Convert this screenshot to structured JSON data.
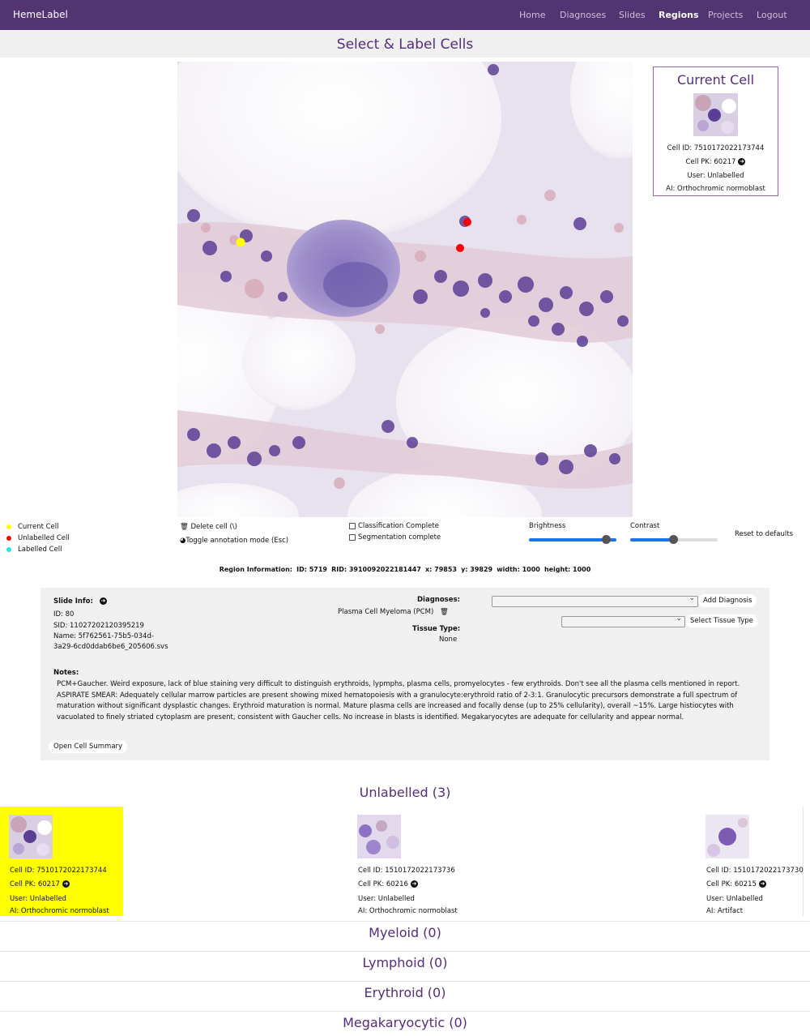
{
  "app": {
    "brand": "HemeLabel",
    "nav": [
      {
        "label": "Home",
        "active": false
      },
      {
        "label": "Diagnoses",
        "active": false
      },
      {
        "label": "Slides",
        "active": false
      },
      {
        "label": "Regions",
        "active": true
      },
      {
        "label": "Projects",
        "active": false
      },
      {
        "label": "Logout",
        "active": false
      }
    ]
  },
  "page_title": "Select & Label Cells",
  "current_cell": {
    "title": "Current Cell",
    "cell_id": "Cell ID: 7510172022173744",
    "cell_pk": "Cell PK: 60217",
    "user": "User: Unlabelled",
    "ai": "AI: Orthochromic normoblast"
  },
  "legend": {
    "current": "Current Cell",
    "unlabelled": "Unlabelled Cell",
    "labelled": "Labelled Cell"
  },
  "controls": {
    "delete": "Delete cell (\\)",
    "toggle": "Toggle annotation mode (Esc)",
    "classification": "Classification Complete",
    "segmentation": "Segmentation complete",
    "brightness": "Brightness",
    "contrast": "Contrast",
    "reset": "Reset to defaults",
    "brightness_value": 0.93,
    "contrast_value": 0.49
  },
  "region_info": {
    "label": "Region Information:",
    "id": "ID: 5719",
    "rid": "RID: 3910092022181447",
    "x": "x: 79853",
    "y": "y: 39829",
    "width": "width: 1000",
    "height": "height: 1000"
  },
  "slide": {
    "label": "Slide Info:",
    "id": "ID: 80",
    "sid": "SID: 11027202120395219",
    "name_line1": "Name: 5f762561-75b5-034d-",
    "name_line2": "3a29-6cd0ddab6be6_205606.svs",
    "diagnoses_label": "Diagnoses:",
    "diagnosis": "Plasma Cell Myeloma (PCM)",
    "tissue_label": "Tissue Type:",
    "tissue": "None",
    "add_diagnosis": "Add Diagnosis",
    "select_tissue": "Select Tissue Type",
    "notes_label": "Notes:",
    "notes": "PCM+Gaucher. Weird exposure, lack of blue staining very difficult to distinguish erythroids, lypmphs, plasma cells, promyelocytes - few erythroids. Don't see all the plasma cells mentioned in report. ASPIRATE SMEAR: Adequately cellular marrow particles are present showing mixed hematopoiesis with a granulocyte:erythroid ratio of 2-3:1. Granulocytic precursors demonstrate a full spectrum of maturation without significant dysplastic changes. Erythroid maturation is normal. Mature plasma cells are increased and focally dense (up to 25% cellularity), overall ~15%. Large histiocytes with vacuolated to finely striated cytoplasm are present, consistent with Gaucher cells. No increase in blasts is identified. Megakaryocytes are adequate for cellularity and appear normal.",
    "open_summary": "Open Cell Summary"
  },
  "sections": {
    "unlabelled": "Unlabelled (3)",
    "myeloid": "Myeloid (0)",
    "lymphoid": "Lymphoid (0)",
    "erythroid": "Erythroid (0)",
    "megakaryocytic": "Megakaryocytic (0)"
  },
  "cells": [
    {
      "cell_id": "Cell ID: 7510172022173744",
      "cell_pk": "Cell PK: 60217",
      "user": "User: Unlabelled",
      "ai": "AI: Orthochromic normoblast"
    },
    {
      "cell_id": "Cell ID: 1510172022173736",
      "cell_pk": "Cell PK: 60216",
      "user": "User: Unlabelled",
      "ai": "AI: Orthochromic normoblast"
    },
    {
      "cell_id": "Cell ID: 1510172022173730",
      "cell_pk": "Cell PK: 60215",
      "user": "User: Unlabelled",
      "ai": "AI: Artifact"
    }
  ],
  "colors": {
    "navbar": "#523473",
    "accent": "#522d80",
    "current_dot": "#ffff00",
    "unlabelled_dot": "#ff0000",
    "labelled_dot": "#22e5e5",
    "slider": "#1a73e8"
  }
}
